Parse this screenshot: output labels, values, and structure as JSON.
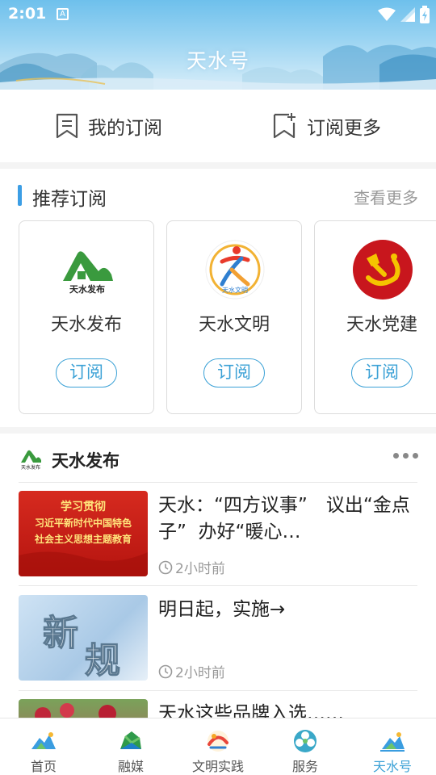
{
  "status_bar": {
    "time": "2:01",
    "notification_glyph": "A"
  },
  "header": {
    "title": "天水号"
  },
  "subbar": [
    {
      "label": "我的订阅",
      "icon": "bookmark-list-icon"
    },
    {
      "label": "订阅更多",
      "icon": "bookmark-add-icon"
    }
  ],
  "recommend": {
    "title": "推荐订阅",
    "more": "查看更多",
    "cards": [
      {
        "name": "天水发布",
        "logo_text": "天水发布",
        "subscribe": "订阅"
      },
      {
        "name": "天水文明",
        "logo_text": "天水文明",
        "subscribe": "订阅"
      },
      {
        "name": "天水党建",
        "subscribe": "订阅"
      }
    ]
  },
  "feed": {
    "source_name": "天水发布",
    "source_logo_text": "天水发布",
    "items": [
      {
        "title": "天水：“四方议事”　议出“金点子”  办好“暖心…",
        "time": "2小时前",
        "thumb_lines": [
          "学习贯彻",
          "习近平新时代中国特色",
          "社会主义思想主题教育"
        ]
      },
      {
        "title": "明日起，实施→",
        "time": "2小时前",
        "thumb_text": "新规"
      },
      {
        "title": "天水这些品牌入选……"
      }
    ]
  },
  "bottom_nav": [
    {
      "label": "首页",
      "active": false
    },
    {
      "label": "融媒",
      "active": false
    },
    {
      "label": "文明实践",
      "active": false
    },
    {
      "label": "服务",
      "active": false
    },
    {
      "label": "天水号",
      "active": true
    }
  ],
  "colors": {
    "accent": "#3ba1d6",
    "header_sky": "#6ec0ec",
    "party_red": "#c8161d"
  }
}
